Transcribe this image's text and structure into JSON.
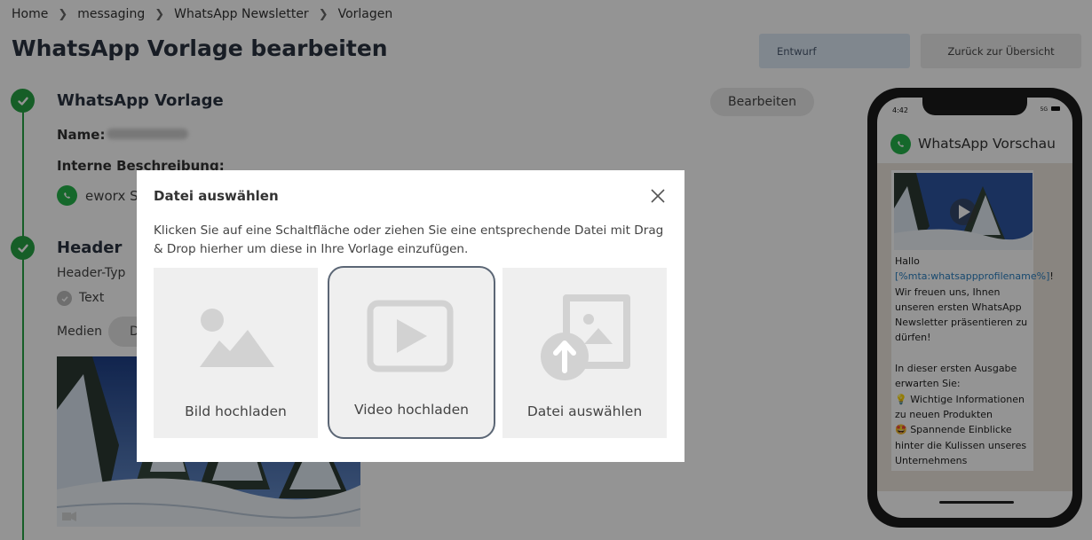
{
  "breadcrumb": [
    "Home",
    "messaging",
    "WhatsApp Newsletter",
    "Vorlagen"
  ],
  "page_title": "WhatsApp Vorlage bearbeiten",
  "actions": {
    "draft_label": "Entwurf",
    "back_label": "Zurück zur Übersicht"
  },
  "section_template": {
    "title": "WhatsApp Vorlage",
    "edit_label": "Bearbeiten",
    "name_label": "Name:",
    "desc_label": "Interne Beschreibung:",
    "account_text": "eworx S"
  },
  "section_header": {
    "title": "Header",
    "type_label": "Header-Typ",
    "type_value": "Text",
    "media_label": "Medien",
    "media_pill": "D"
  },
  "phone": {
    "time": "4:42",
    "status": "5G",
    "title": "WhatsApp Vorschau",
    "msg_greeting": "Hallo",
    "msg_placeholder": "[%mta:whatsappprofilename%]",
    "msg_rest": "!\nWir freuen uns, Ihnen unseren ersten WhatsApp Newsletter präsentieren zu dürfen!\n\nIn dieser ersten Ausgabe erwarten Sie:\n💡 Wichtige Informationen zu neuen Produkten\n🤩 Spannende Einblicke hinter die Kulissen unseres Unternehmens"
  },
  "modal": {
    "title": "Datei auswählen",
    "description": "Klicken Sie auf eine Schaltfläche oder ziehen Sie eine entsprechende Datei mit Drag & Drop hierher um diese in Ihre Vorlage einzufügen.",
    "options": [
      {
        "label": "Bild hochladen",
        "icon": "image-icon"
      },
      {
        "label": "Video hochladen",
        "icon": "video-play-icon",
        "selected": true
      },
      {
        "label": "Datei auswählen",
        "icon": "file-upload-icon"
      }
    ]
  },
  "colors": {
    "success_green": "#27a344",
    "whatsapp_green": "#25b34a",
    "draft_bg": "#dde8f5",
    "overlay": "rgba(0,0,0,0.42)",
    "link_blue": "#2a7fc0"
  }
}
